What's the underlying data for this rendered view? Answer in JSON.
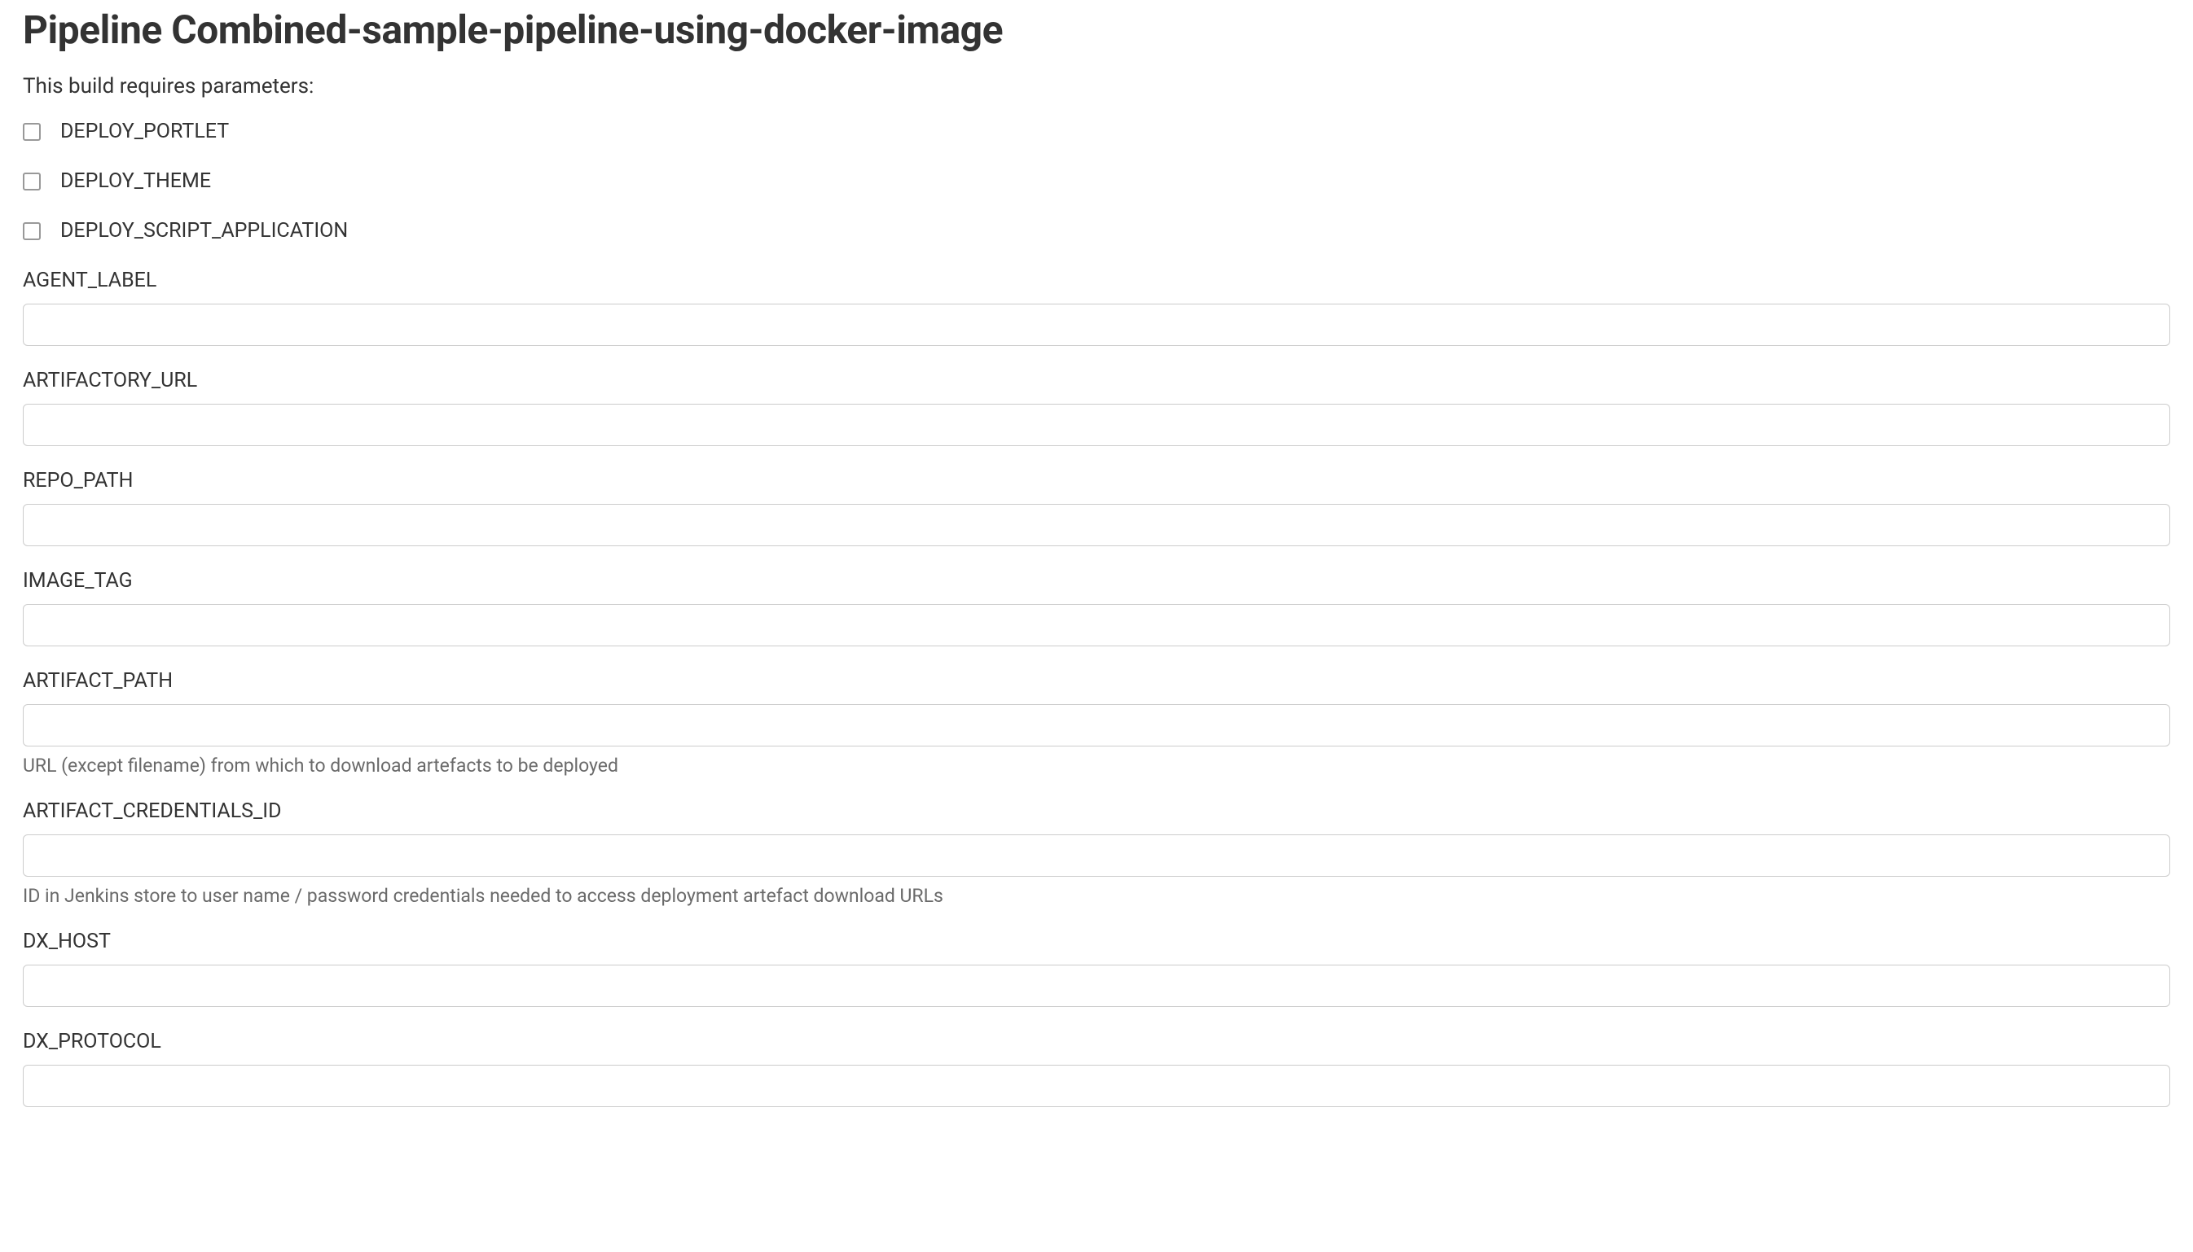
{
  "title": "Pipeline Combined-sample-pipeline-using-docker-image",
  "subtitle": "This build requires parameters:",
  "checkboxes": [
    {
      "label": "DEPLOY_PORTLET"
    },
    {
      "label": "DEPLOY_THEME"
    },
    {
      "label": "DEPLOY_SCRIPT_APPLICATION"
    }
  ],
  "fields": {
    "agent_label": {
      "label": "AGENT_LABEL",
      "value": ""
    },
    "artifactory_url": {
      "label": "ARTIFACTORY_URL",
      "value": ""
    },
    "repo_path": {
      "label": "REPO_PATH",
      "value": ""
    },
    "image_tag": {
      "label": "IMAGE_TAG",
      "value": ""
    },
    "artifact_path": {
      "label": "ARTIFACT_PATH",
      "value": "",
      "help": "URL (except filename) from which to download artefacts to be deployed"
    },
    "artifact_credentials_id": {
      "label": "ARTIFACT_CREDENTIALS_ID",
      "value": "",
      "help": "ID in Jenkins store to user name / password credentials needed to access deployment artefact download URLs"
    },
    "dx_host": {
      "label": "DX_HOST",
      "value": ""
    },
    "dx_protocol": {
      "label": "DX_PROTOCOL",
      "value": ""
    }
  }
}
